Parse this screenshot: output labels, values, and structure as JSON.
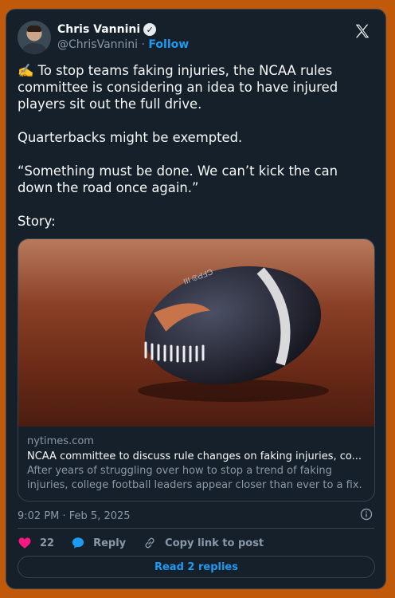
{
  "author": {
    "display_name": "Chris Vannini",
    "handle": "@ChrisVannini",
    "separator": "·",
    "follow_label": "Follow",
    "verified_icon": "verified-badge-icon"
  },
  "tweet": {
    "text": "✍️ To stop teams faking injuries, the NCAA rules committee is considering an idea to have injured players sit out the full drive.\n\nQuarterbacks might be exempted.\n\n“Something must be done. We can’t kick the can down the road once again.”\n\nStory:"
  },
  "link_card": {
    "image_alt": "football-on-turf",
    "ball_print": "CFP® III",
    "domain": "nytimes.com",
    "title": "NCAA committee to discuss rule changes on faking injuries, co...",
    "description": "After years of struggling over how to stop a trend of faking injuries, college football leaders appear closer than ever to a fix."
  },
  "timestamp": "9:02 PM · Feb 5, 2025",
  "actions": {
    "like_count": "22",
    "reply_label": "Reply",
    "copy_label": "Copy link to post"
  },
  "read_replies_label": "Read 2 replies",
  "colors": {
    "page_background": "#c05a0a",
    "card_background": "#15202b",
    "accent_blue": "#1d9bf0",
    "like_pink": "#f91880",
    "muted_text": "#8b98a5"
  }
}
